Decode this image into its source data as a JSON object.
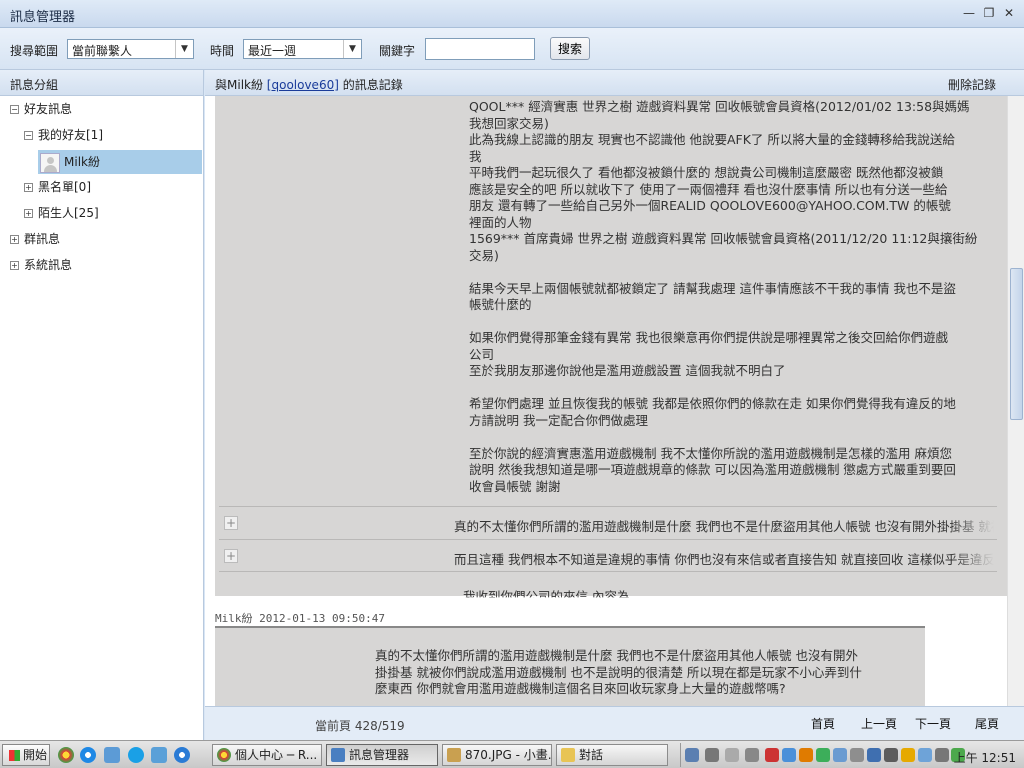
{
  "window": {
    "title": "訊息管理器",
    "controls": [
      "—",
      "❐",
      "✕"
    ]
  },
  "search": {
    "scope_label": "搜尋範圍",
    "scope_value": "當前聯繫人",
    "time_label": "時間",
    "time_value": "最近一週",
    "keyword_label": "關鍵字",
    "keyword_value": "",
    "search_button": "搜索"
  },
  "sidebar": {
    "header": "訊息分組",
    "tree": [
      {
        "label": "好友訊息",
        "toggle": "−"
      },
      {
        "label": "我的好友[1]",
        "toggle": "−"
      },
      {
        "label": "Milk紛",
        "toggle": ""
      },
      {
        "label": "黑名單[0]",
        "toggle": "+"
      },
      {
        "label": "陌生人[25]",
        "toggle": "+"
      },
      {
        "label": "群訊息",
        "toggle": "+"
      },
      {
        "label": "系統訊息",
        "toggle": "+"
      }
    ]
  },
  "conversation": {
    "prefix": "與Milk紛 ",
    "contact_link": "[qoolove60]",
    "suffix": " 的訊息記錄",
    "delete_label": "刪除記錄"
  },
  "messages": {
    "expanded_text": "QOOL*** 經濟實惠 世界之樹 遊戲資料異常 回收帳號會員資格(2012/01/02 13:58與媽媽\n我想回家交易)\n此為我線上認識的朋友 現實也不認識他 他說要AFK了 所以將大量的金錢轉移給我說送給\n我\n平時我們一起玩很久了 看他都沒被鎖什麼的 想說貴公司機制這麼嚴密 既然他都沒被鎖\n應該是安全的吧 所以就收下了 使用了一兩個禮拜 看也沒什麼事情 所以也有分送一些給\n朋友 還有轉了一些給自己另外一個REALID QOOLOVE600@YAHOO.COM.TW 的帳號\n裡面的人物\n1569*** 首席貴婦 世界之樹 遊戲資料異常 回收帳號會員資格(2011/12/20 11:12與攘街紛\n交易)\n\n結果今天早上兩個帳號就都被鎖定了 請幫我處理 這件事情應該不干我的事情 我也不是盜\n帳號什麼的\n\n如果你們覺得那筆金錢有異常 我也很樂意再你們提供說是哪裡異常之後交回給你們遊戲\n公司\n至於我朋友那邊你說他是濫用遊戲設置 這個我就不明白了\n\n希望你們處理 並且恢復我的帳號 我都是依照你們的條款在走 如果你們覺得我有違反的地\n方請說明 我一定配合你們做處理\n\n至於你說的經濟實惠濫用遊戲機制 我不太懂你所說的濫用遊戲機制是怎樣的濫用 麻煩您\n說明 然後我想知道是哪一項遊戲規章的條款 可以因為濫用遊戲機制 懲處方式嚴重到要回\n收會員帳號 謝謝",
    "collapsed": [
      {
        "toggle": "+",
        "text": "真的不太懂你們所謂的濫用遊戲機制是什麼 我們也不是什麼盜用其他人帳號 也沒有開外掛掛基 就被你們說成濫用遊戲機制"
      },
      {
        "toggle": "+",
        "text": "而且這種 我們根本不知道是違規的事情 你們也沒有來信或者直接告知 就直接回收 這樣似乎是違反了"
      }
    ],
    "cutoff_text": "我收到你們公司的來信 內容為",
    "sender_line": "Milk紛 2012-01-13 09:50:47",
    "second_message": "真的不太懂你們所謂的濫用遊戲機制是什麼 我們也不是什麼盜用其他人帳號 也沒有開外\n掛掛基 就被你們說成濫用遊戲機制 也不是說明的很清楚 所以現在都是玩家不小心弄到什\n麼東西 你們就會用濫用遊戲機制這個名目來回收玩家身上大量的遊戲幣嗎?"
  },
  "pagination": {
    "current_page_text": "當前頁 428/519",
    "first": "首頁",
    "prev": "上一頁",
    "next": "下一頁",
    "last": "尾頁"
  },
  "taskbar": {
    "start_label": "開始",
    "tasks": [
      {
        "label": "個人中心 ─ R...",
        "icon": "chrome-icon",
        "active": false
      },
      {
        "label": "訊息管理器",
        "icon": "qq-icon",
        "active": true
      },
      {
        "label": "870.JPG - 小畫...",
        "icon": "paint-icon",
        "active": false
      },
      {
        "label": "對話",
        "icon": "folder-icon",
        "active": false
      }
    ],
    "clock": "上午 12:51"
  },
  "colors": {
    "selected_row": "#a8cde9",
    "message_bg": "#d7d6d5",
    "link": "#1a3c9a"
  }
}
